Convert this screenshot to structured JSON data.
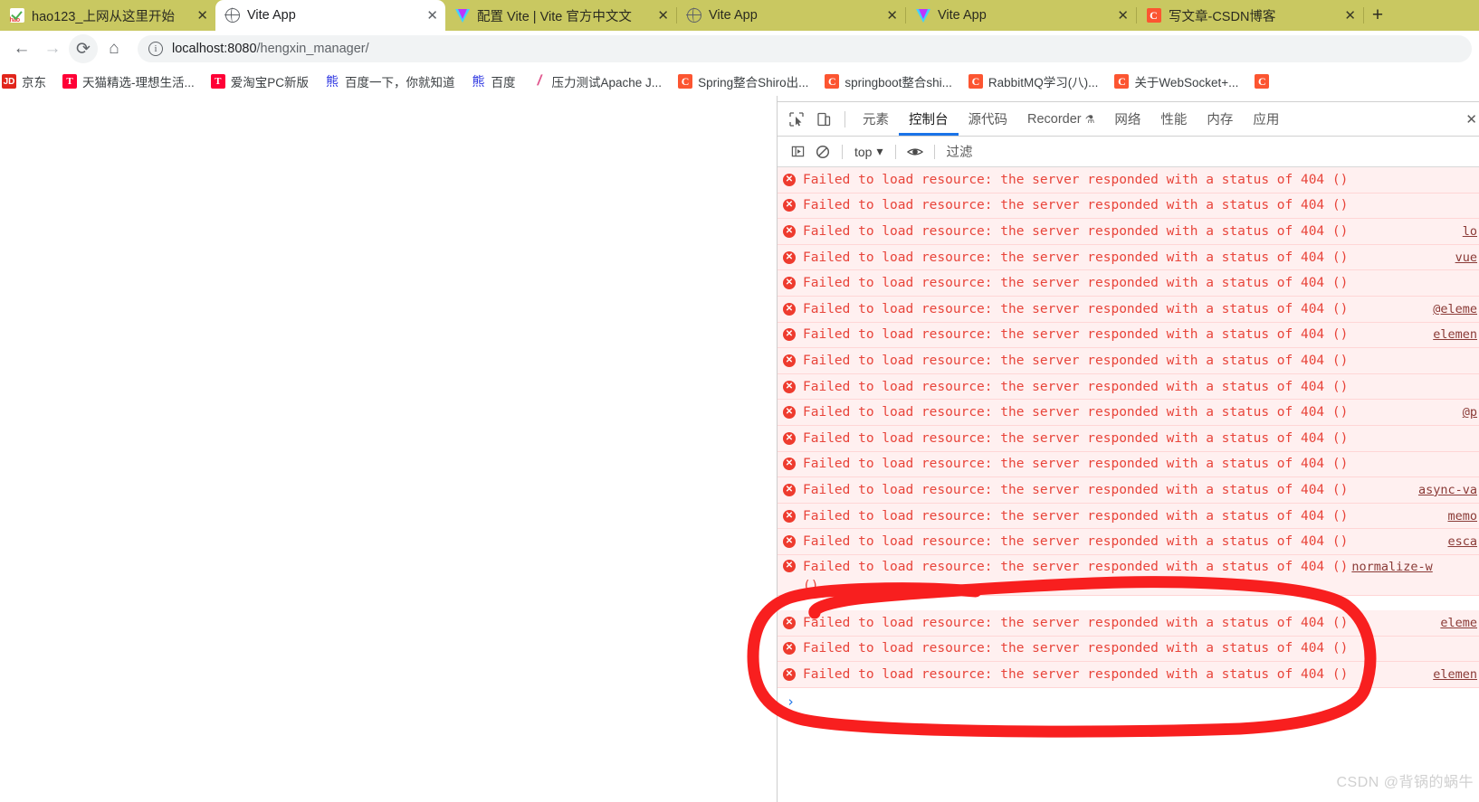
{
  "browser": {
    "tabs": [
      {
        "title": "hao123_上网从这里开始",
        "icon": "hao123-icon",
        "active": false,
        "close_label": "✕"
      },
      {
        "title": "Vite App",
        "icon": "globe-icon",
        "active": true,
        "close_label": "✕"
      },
      {
        "title": "配置 Vite | Vite 官方中文文",
        "icon": "vite-icon",
        "active": false,
        "close_label": "✕"
      },
      {
        "title": "Vite App",
        "icon": "globe-icon",
        "active": false,
        "close_label": "✕"
      },
      {
        "title": "Vite App",
        "icon": "vite-icon",
        "active": false,
        "close_label": "✕"
      },
      {
        "title": "写文章-CSDN博客",
        "icon": "csdn-icon",
        "active": false,
        "close_label": "✕"
      }
    ],
    "new_tab_label": "+",
    "tabstrip_color": "#c9c861",
    "toolbar": {
      "back_label": "←",
      "forward_label": "→",
      "reload_label": "⟳",
      "home_label": "⌂",
      "info_label": "i",
      "url_host": "localhost:8080",
      "url_path": "/hengxin_manager/"
    },
    "bookmarks": [
      {
        "label": "京东",
        "icon": "jd-icon",
        "glyph": "JD"
      },
      {
        "label": "天猫精选-理想生活...",
        "icon": "tmall-icon",
        "glyph": "T"
      },
      {
        "label": "爱淘宝PC新版",
        "icon": "tmall-icon",
        "glyph": "T"
      },
      {
        "label": "百度一下，你就知道",
        "icon": "baidu-icon",
        "glyph": "熊"
      },
      {
        "label": "百度",
        "icon": "baidu-icon",
        "glyph": "熊"
      },
      {
        "label": "压力测试Apache J...",
        "icon": "jmeter-icon",
        "glyph": "/"
      },
      {
        "label": "Spring整合Shiro出...",
        "icon": "csdn-icon",
        "glyph": "C"
      },
      {
        "label": "springboot整合shi...",
        "icon": "csdn-icon",
        "glyph": "C"
      },
      {
        "label": "RabbitMQ学习(八)...",
        "icon": "csdn-icon",
        "glyph": "C"
      },
      {
        "label": "关于WebSocket+...",
        "icon": "csdn-icon",
        "glyph": "C"
      },
      {
        "label": "",
        "icon": "csdn-icon",
        "glyph": "C"
      }
    ]
  },
  "devtools": {
    "inspect_icon_label": "⌖",
    "device_icon_label": "▢",
    "tabs": [
      {
        "label": "元素",
        "selected": false
      },
      {
        "label": "控制台",
        "selected": true
      },
      {
        "label": "源代码",
        "selected": false
      },
      {
        "label": "Recorder",
        "selected": false,
        "beaker": "⚗"
      },
      {
        "label": "网络",
        "selected": false
      },
      {
        "label": "性能",
        "selected": false
      },
      {
        "label": "内存",
        "selected": false
      },
      {
        "label": "应用",
        "selected": false
      }
    ],
    "close_label": "✕",
    "filterbar": {
      "sidebar_toggle_label": "▣",
      "clear_label": "⃠",
      "context_label": "top",
      "context_caret": "▾",
      "eye_label": "◉",
      "filter_placeholder": "过滤"
    },
    "console": {
      "message": "Failed to load resource: the server responded with a status of 404 ()",
      "rows": [
        {
          "source": ""
        },
        {
          "source": ""
        },
        {
          "source": "lo"
        },
        {
          "source": "vue"
        },
        {
          "source": ""
        },
        {
          "source": "@eleme"
        },
        {
          "source": "elemen"
        },
        {
          "source": ""
        },
        {
          "source": ""
        },
        {
          "source": "@p"
        },
        {
          "source": ""
        },
        {
          "source": ""
        },
        {
          "source": "async-va"
        },
        {
          "source": "memo"
        },
        {
          "source": "esca"
        },
        {
          "source": "normalize-w",
          "inline": true,
          "wrapped": "()"
        },
        {
          "source": "eleme"
        },
        {
          "source": ""
        },
        {
          "source": "elemen"
        }
      ],
      "prompt_caret": "›"
    }
  },
  "annotation": {
    "type": "red-circle-highlight",
    "color": "#f81f1f"
  },
  "watermark": "CSDN @背锅的蜗牛"
}
